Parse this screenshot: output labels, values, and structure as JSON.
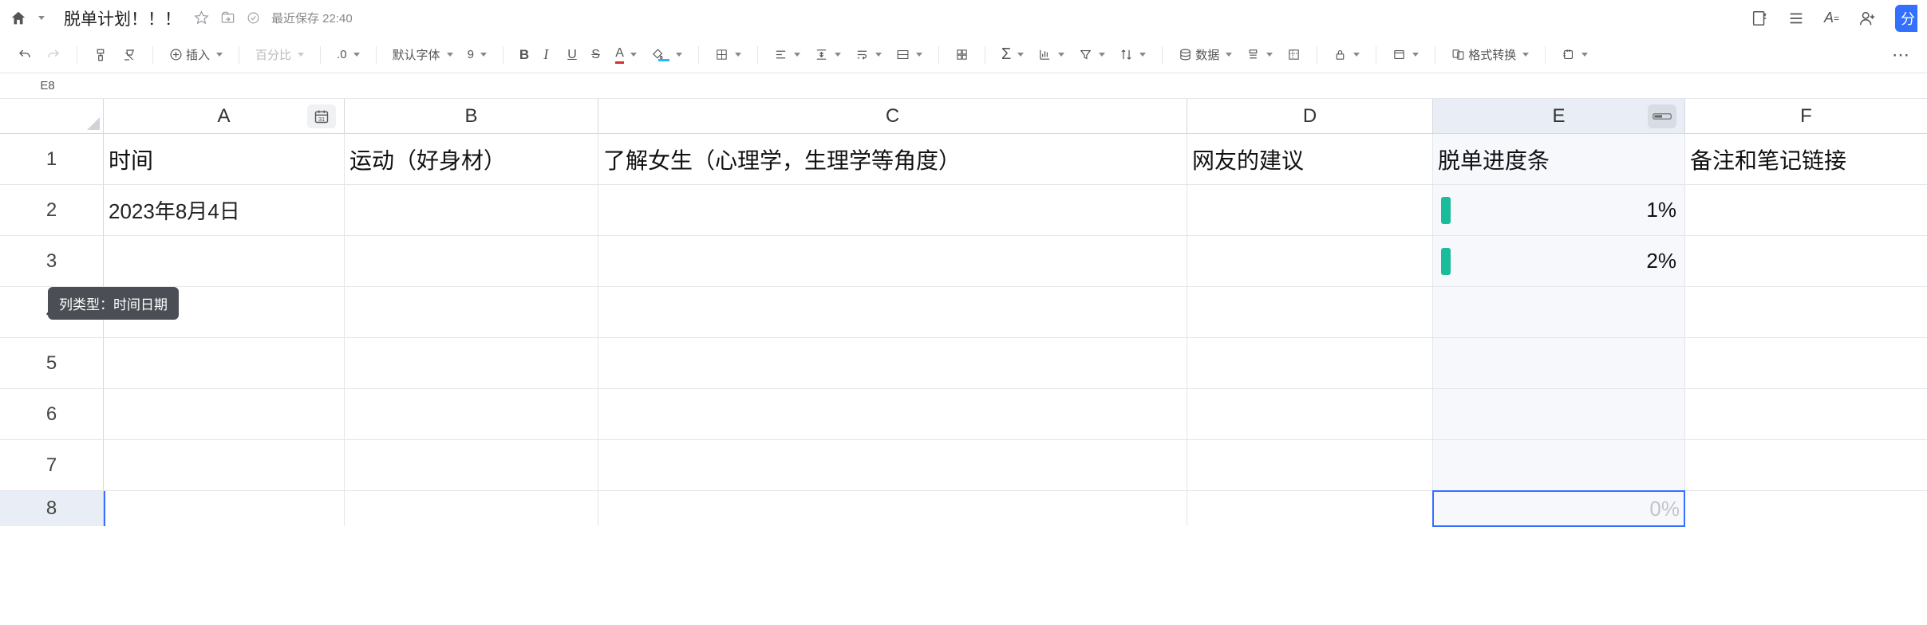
{
  "titlebar": {
    "doc_title": "脱单计划！！！",
    "save_status": "最近保存 22:40"
  },
  "toolbar": {
    "insert_label": "插入",
    "zoom_placeholder": "百分比",
    "decimal_label": ".0",
    "font_placeholder": "默认字体",
    "font_size": "9",
    "data_label": "数据",
    "format_convert_label": "格式转换"
  },
  "formula": {
    "cell_ref": "E8"
  },
  "tooltip": "列类型：时间日期",
  "columns": [
    {
      "letter": "A",
      "cls": "cA",
      "typeIcon": "calendar"
    },
    {
      "letter": "B",
      "cls": "cB"
    },
    {
      "letter": "C",
      "cls": "cC"
    },
    {
      "letter": "D",
      "cls": "cD"
    },
    {
      "letter": "E",
      "cls": "cE",
      "selected": true,
      "typeIcon": "progress"
    },
    {
      "letter": "F",
      "cls": "cF"
    }
  ],
  "header_row": {
    "A": "时间",
    "B": "运动（好身材）",
    "C": "了解女生（心理学，生理学等角度）",
    "D": "网友的建议",
    "E": "脱单进度条",
    "F": "备注和笔记链接"
  },
  "rows": [
    {
      "n": "1"
    },
    {
      "n": "2",
      "A": "2023年8月4日",
      "E_pct": "1%"
    },
    {
      "n": "3",
      "E_pct": "2%"
    },
    {
      "n": "4"
    },
    {
      "n": "5"
    },
    {
      "n": "6"
    },
    {
      "n": "7"
    },
    {
      "n": "8",
      "active": true,
      "E_ghost": "0%"
    }
  ]
}
